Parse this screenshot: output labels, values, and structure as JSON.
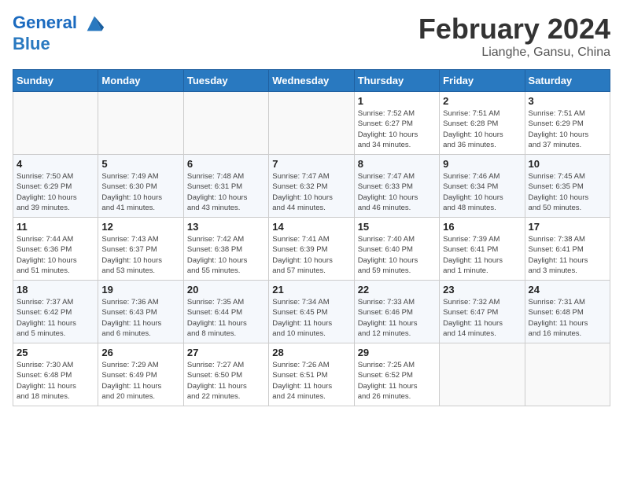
{
  "header": {
    "logo_line1": "General",
    "logo_line2": "Blue",
    "month": "February 2024",
    "location": "Lianghe, Gansu, China"
  },
  "weekdays": [
    "Sunday",
    "Monday",
    "Tuesday",
    "Wednesday",
    "Thursday",
    "Friday",
    "Saturday"
  ],
  "weeks": [
    [
      {
        "day": "",
        "info": ""
      },
      {
        "day": "",
        "info": ""
      },
      {
        "day": "",
        "info": ""
      },
      {
        "day": "",
        "info": ""
      },
      {
        "day": "1",
        "info": "Sunrise: 7:52 AM\nSunset: 6:27 PM\nDaylight: 10 hours\nand 34 minutes."
      },
      {
        "day": "2",
        "info": "Sunrise: 7:51 AM\nSunset: 6:28 PM\nDaylight: 10 hours\nand 36 minutes."
      },
      {
        "day": "3",
        "info": "Sunrise: 7:51 AM\nSunset: 6:29 PM\nDaylight: 10 hours\nand 37 minutes."
      }
    ],
    [
      {
        "day": "4",
        "info": "Sunrise: 7:50 AM\nSunset: 6:29 PM\nDaylight: 10 hours\nand 39 minutes."
      },
      {
        "day": "5",
        "info": "Sunrise: 7:49 AM\nSunset: 6:30 PM\nDaylight: 10 hours\nand 41 minutes."
      },
      {
        "day": "6",
        "info": "Sunrise: 7:48 AM\nSunset: 6:31 PM\nDaylight: 10 hours\nand 43 minutes."
      },
      {
        "day": "7",
        "info": "Sunrise: 7:47 AM\nSunset: 6:32 PM\nDaylight: 10 hours\nand 44 minutes."
      },
      {
        "day": "8",
        "info": "Sunrise: 7:47 AM\nSunset: 6:33 PM\nDaylight: 10 hours\nand 46 minutes."
      },
      {
        "day": "9",
        "info": "Sunrise: 7:46 AM\nSunset: 6:34 PM\nDaylight: 10 hours\nand 48 minutes."
      },
      {
        "day": "10",
        "info": "Sunrise: 7:45 AM\nSunset: 6:35 PM\nDaylight: 10 hours\nand 50 minutes."
      }
    ],
    [
      {
        "day": "11",
        "info": "Sunrise: 7:44 AM\nSunset: 6:36 PM\nDaylight: 10 hours\nand 51 minutes."
      },
      {
        "day": "12",
        "info": "Sunrise: 7:43 AM\nSunset: 6:37 PM\nDaylight: 10 hours\nand 53 minutes."
      },
      {
        "day": "13",
        "info": "Sunrise: 7:42 AM\nSunset: 6:38 PM\nDaylight: 10 hours\nand 55 minutes."
      },
      {
        "day": "14",
        "info": "Sunrise: 7:41 AM\nSunset: 6:39 PM\nDaylight: 10 hours\nand 57 minutes."
      },
      {
        "day": "15",
        "info": "Sunrise: 7:40 AM\nSunset: 6:40 PM\nDaylight: 10 hours\nand 59 minutes."
      },
      {
        "day": "16",
        "info": "Sunrise: 7:39 AM\nSunset: 6:41 PM\nDaylight: 11 hours\nand 1 minute."
      },
      {
        "day": "17",
        "info": "Sunrise: 7:38 AM\nSunset: 6:41 PM\nDaylight: 11 hours\nand 3 minutes."
      }
    ],
    [
      {
        "day": "18",
        "info": "Sunrise: 7:37 AM\nSunset: 6:42 PM\nDaylight: 11 hours\nand 5 minutes."
      },
      {
        "day": "19",
        "info": "Sunrise: 7:36 AM\nSunset: 6:43 PM\nDaylight: 11 hours\nand 6 minutes."
      },
      {
        "day": "20",
        "info": "Sunrise: 7:35 AM\nSunset: 6:44 PM\nDaylight: 11 hours\nand 8 minutes."
      },
      {
        "day": "21",
        "info": "Sunrise: 7:34 AM\nSunset: 6:45 PM\nDaylight: 11 hours\nand 10 minutes."
      },
      {
        "day": "22",
        "info": "Sunrise: 7:33 AM\nSunset: 6:46 PM\nDaylight: 11 hours\nand 12 minutes."
      },
      {
        "day": "23",
        "info": "Sunrise: 7:32 AM\nSunset: 6:47 PM\nDaylight: 11 hours\nand 14 minutes."
      },
      {
        "day": "24",
        "info": "Sunrise: 7:31 AM\nSunset: 6:48 PM\nDaylight: 11 hours\nand 16 minutes."
      }
    ],
    [
      {
        "day": "25",
        "info": "Sunrise: 7:30 AM\nSunset: 6:48 PM\nDaylight: 11 hours\nand 18 minutes."
      },
      {
        "day": "26",
        "info": "Sunrise: 7:29 AM\nSunset: 6:49 PM\nDaylight: 11 hours\nand 20 minutes."
      },
      {
        "day": "27",
        "info": "Sunrise: 7:27 AM\nSunset: 6:50 PM\nDaylight: 11 hours\nand 22 minutes."
      },
      {
        "day": "28",
        "info": "Sunrise: 7:26 AM\nSunset: 6:51 PM\nDaylight: 11 hours\nand 24 minutes."
      },
      {
        "day": "29",
        "info": "Sunrise: 7:25 AM\nSunset: 6:52 PM\nDaylight: 11 hours\nand 26 minutes."
      },
      {
        "day": "",
        "info": ""
      },
      {
        "day": "",
        "info": ""
      }
    ]
  ]
}
